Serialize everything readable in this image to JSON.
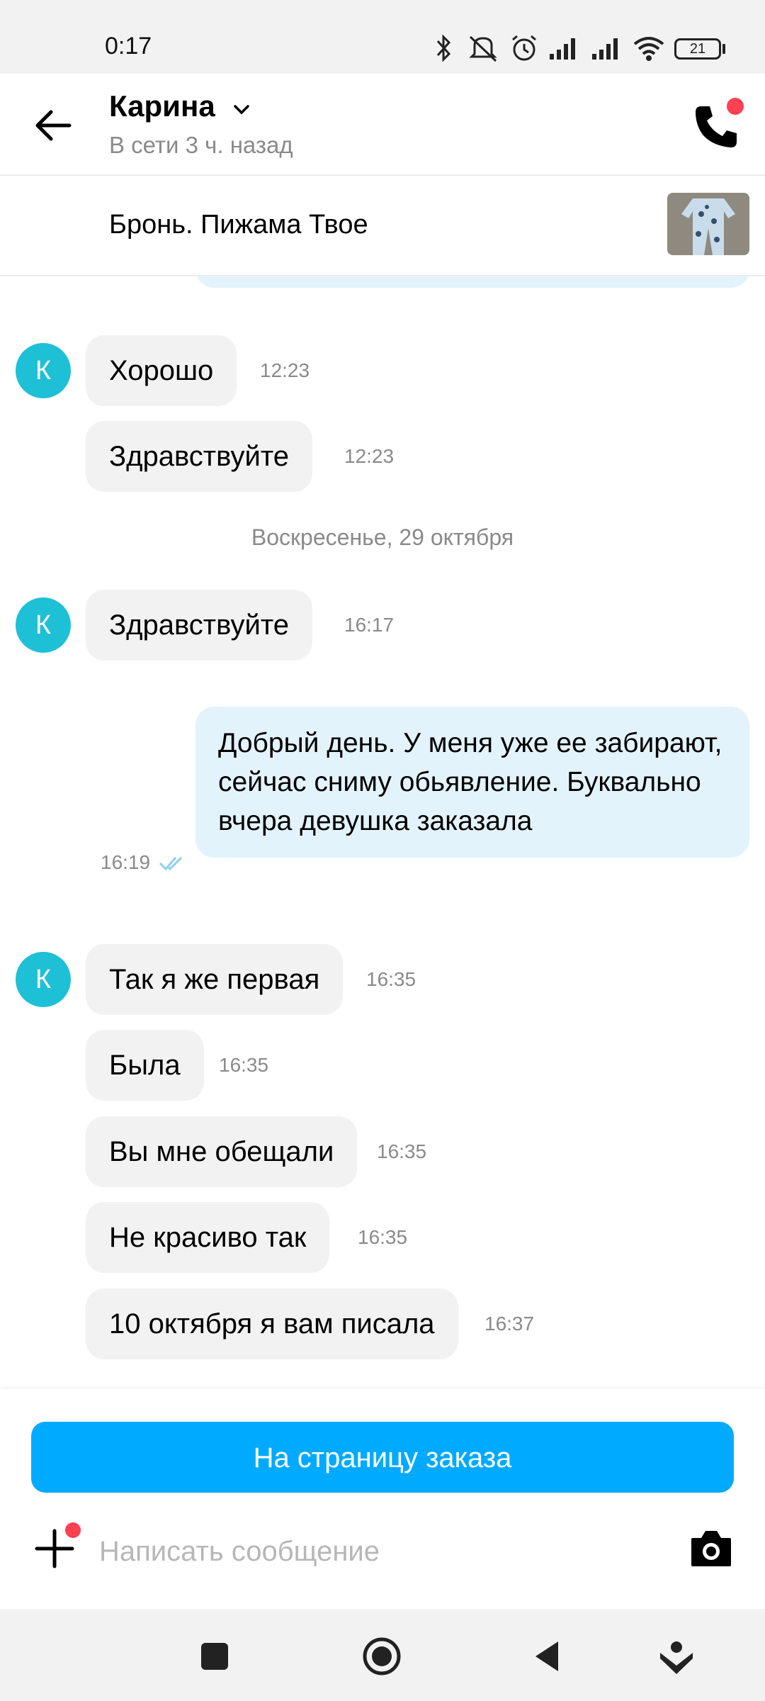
{
  "status_bar": {
    "time": "0:17",
    "battery": "21",
    "icons": [
      "bluetooth-icon",
      "mute-icon",
      "alarm-icon",
      "signal-icon",
      "signal-icon",
      "wifi-icon",
      "battery-icon"
    ]
  },
  "header": {
    "name": "Карина",
    "status": "В сети 3 ч. назад",
    "icons": {
      "back": "arrow-left-icon",
      "call": "phone-icon"
    },
    "accent": "#ff4053"
  },
  "listing": {
    "title": "Бронь. Пижама Твое"
  },
  "messages": [
    {
      "side": "in",
      "avatar": "К",
      "text": "Хорошо",
      "time": "12:23"
    },
    {
      "side": "in",
      "text": "Здравствуйте",
      "time": "12:23"
    },
    {
      "type": "date",
      "text": "Воскресенье, 29 октября"
    },
    {
      "side": "in",
      "avatar": "К",
      "text": "Здравствуйте",
      "time": "16:17"
    },
    {
      "side": "out",
      "text": "Добрый день. У меня уже ее забирают, сейчас сниму обьявление. Буквально вчера девушка заказала",
      "time": "16:19",
      "read": true
    },
    {
      "side": "in",
      "avatar": "К",
      "text": "Так я же первая",
      "time": "16:35"
    },
    {
      "side": "in",
      "text": "Была",
      "time": "16:35"
    },
    {
      "side": "in",
      "text": "Вы мне обещали",
      "time": "16:35"
    },
    {
      "side": "in",
      "text": "Не красиво так",
      "time": "16:35"
    },
    {
      "side": "in",
      "text": "10 октября я вам писала",
      "time": "16:37"
    }
  ],
  "bottom": {
    "order_button": "На страницу заказа",
    "input_placeholder": "Написать сообщение",
    "brand_color": "#00aaff"
  },
  "nav": {
    "icons": [
      "recents-icon",
      "home-icon",
      "back-icon",
      "assistant-icon"
    ]
  }
}
